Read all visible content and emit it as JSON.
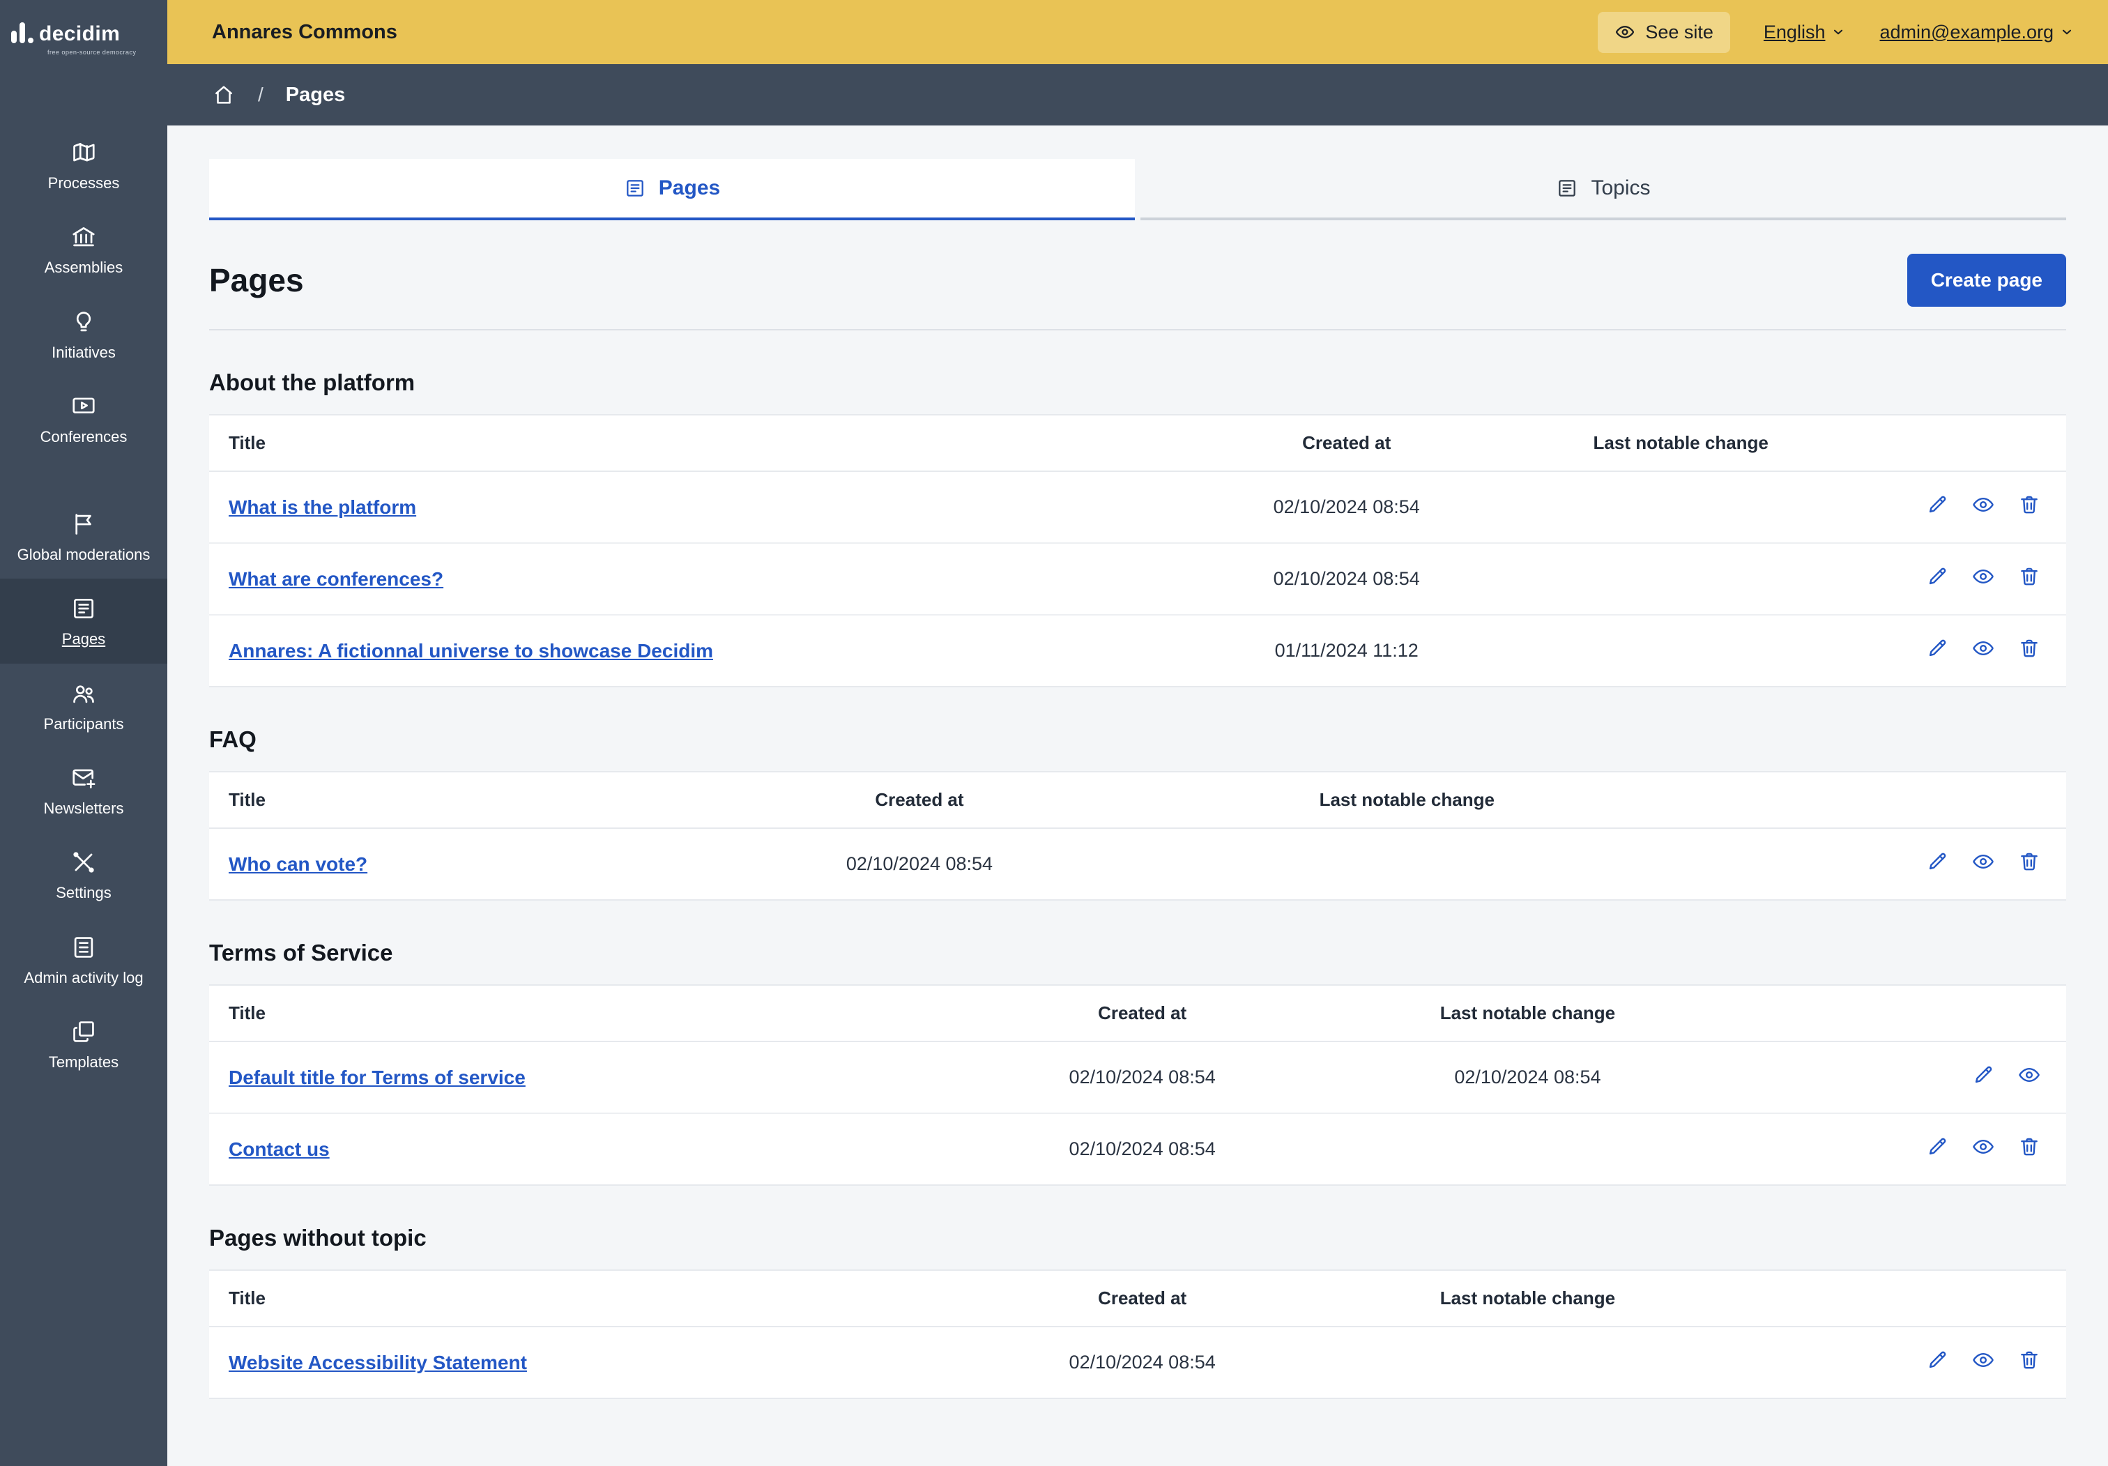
{
  "topbar": {
    "title": "Annares Commons",
    "see_site": "See site",
    "language": "English",
    "account": "admin@example.org"
  },
  "breadcrumb": {
    "current": "Pages"
  },
  "sidebar": {
    "logo_text": "decidim",
    "logo_tagline": "free open-source democracy",
    "items": [
      {
        "label": "Processes",
        "icon": "map",
        "active": false,
        "gap_before": false
      },
      {
        "label": "Assemblies",
        "icon": "government",
        "active": false,
        "gap_before": false
      },
      {
        "label": "Initiatives",
        "icon": "lightbulb",
        "active": false,
        "gap_before": false
      },
      {
        "label": "Conferences",
        "icon": "video-screen",
        "active": false,
        "gap_before": false
      },
      {
        "label": "Global moderations",
        "icon": "flag",
        "active": false,
        "gap_before": true
      },
      {
        "label": "Pages",
        "icon": "book",
        "active": true,
        "gap_before": false
      },
      {
        "label": "Participants",
        "icon": "team",
        "active": false,
        "gap_before": false
      },
      {
        "label": "Newsletters",
        "icon": "mail-add",
        "active": false,
        "gap_before": false
      },
      {
        "label": "Settings",
        "icon": "tools",
        "active": false,
        "gap_before": false
      },
      {
        "label": "Admin activity log",
        "icon": "file-list",
        "active": false,
        "gap_before": false
      },
      {
        "label": "Templates",
        "icon": "copy",
        "active": false,
        "gap_before": false
      }
    ]
  },
  "tabs": [
    {
      "label": "Pages",
      "icon": "book",
      "active": true
    },
    {
      "label": "Topics",
      "icon": "book",
      "active": false
    }
  ],
  "page": {
    "title": "Pages",
    "create_button": "Create page"
  },
  "sections": [
    {
      "title": "About the platform",
      "headers": [
        "Title",
        "Created at",
        "Last notable change"
      ],
      "rows": [
        {
          "title": "What is the platform",
          "created_at": "02/10/2024 08:54",
          "last_notable_change": "",
          "actions": [
            "edit",
            "preview",
            "delete"
          ]
        },
        {
          "title": "What are conferences?",
          "created_at": "02/10/2024 08:54",
          "last_notable_change": "",
          "actions": [
            "edit",
            "preview",
            "delete"
          ]
        },
        {
          "title": "Annares: A fictionnal universe to showcase Decidim",
          "created_at": "01/11/2024 11:12",
          "last_notable_change": "",
          "actions": [
            "edit",
            "preview",
            "delete"
          ]
        }
      ]
    },
    {
      "title": "FAQ",
      "headers": [
        "Title",
        "Created at",
        "Last notable change"
      ],
      "rows": [
        {
          "title": "Who can vote?",
          "created_at": "02/10/2024 08:54",
          "last_notable_change": "",
          "actions": [
            "edit",
            "preview",
            "delete"
          ]
        }
      ]
    },
    {
      "title": "Terms of Service",
      "headers": [
        "Title",
        "Created at",
        "Last notable change"
      ],
      "rows": [
        {
          "title": "Default title for Terms of service",
          "created_at": "02/10/2024 08:54",
          "last_notable_change": "02/10/2024 08:54",
          "actions": [
            "edit",
            "preview"
          ]
        },
        {
          "title": "Contact us",
          "created_at": "02/10/2024 08:54",
          "last_notable_change": "",
          "actions": [
            "edit",
            "preview",
            "delete"
          ]
        }
      ]
    },
    {
      "title": "Pages without topic",
      "headers": [
        "Title",
        "Created at",
        "Last notable change"
      ],
      "rows": [
        {
          "title": "Website Accessibility Statement",
          "created_at": "02/10/2024 08:54",
          "last_notable_change": "",
          "actions": [
            "edit",
            "preview",
            "delete"
          ]
        }
      ]
    }
  ]
}
